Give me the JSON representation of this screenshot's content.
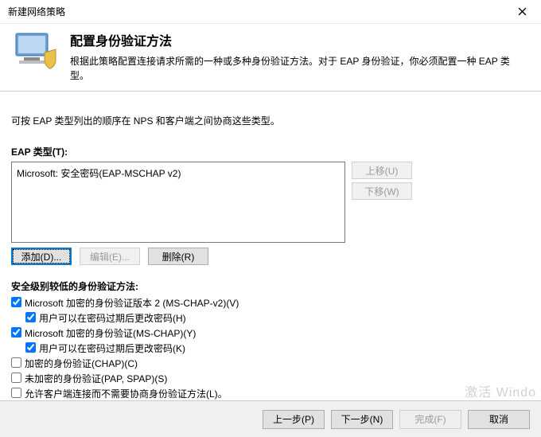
{
  "window": {
    "title": "新建网络策略"
  },
  "header": {
    "heading": "配置身份验证方法",
    "description": "根据此策略配置连接请求所需的一种或多种身份验证方法。对于 EAP 身份验证，你必须配置一种 EAP 类型。"
  },
  "intro": "可按 EAP 类型列出的顺序在 NPS 和客户端之间协商这些类型。",
  "eap": {
    "label": "EAP 类型(T):",
    "items": [
      "Microsoft: 安全密码(EAP-MSCHAP v2)"
    ],
    "move_up": "上移(U)",
    "move_down": "下移(W)",
    "add": "添加(D)...",
    "edit": "编辑(E)...",
    "remove": "删除(R)"
  },
  "less": {
    "title": "安全级别较低的身份验证方法:",
    "opts": [
      {
        "label": "Microsoft 加密的身份验证版本 2 (MS-CHAP-v2)(V)",
        "checked": true,
        "indent": false
      },
      {
        "label": "用户可以在密码过期后更改密码(H)",
        "checked": true,
        "indent": true
      },
      {
        "label": "Microsoft 加密的身份验证(MS-CHAP)(Y)",
        "checked": true,
        "indent": false
      },
      {
        "label": "用户可以在密码过期后更改密码(K)",
        "checked": true,
        "indent": true
      },
      {
        "label": "加密的身份验证(CHAP)(C)",
        "checked": false,
        "indent": false
      },
      {
        "label": "未加密的身份验证(PAP, SPAP)(S)",
        "checked": false,
        "indent": false
      },
      {
        "label": "允许客户端连接而不需要协商身份验证方法(L)。",
        "checked": false,
        "indent": false
      }
    ]
  },
  "footer": {
    "back": "上一步(P)",
    "next": "下一步(N)",
    "finish": "完成(F)",
    "cancel": "取消"
  },
  "watermark": "激活 Windo"
}
